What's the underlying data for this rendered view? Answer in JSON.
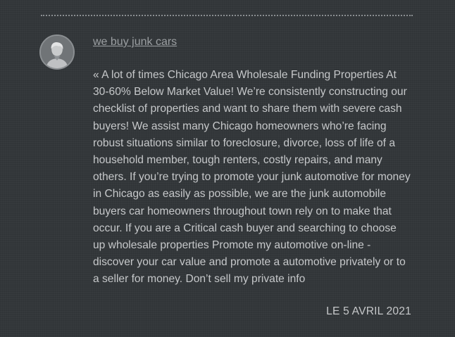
{
  "comment": {
    "author": "we buy junk cars",
    "avatar_icon": "user-avatar-icon",
    "body": "« A lot of times Chicago Area Wholesale Funding Properties At 30-60% Below Market Value! We’re consistently constructing our checklist of properties and want to share them with severe cash buyers! We assist many Chicago homeowners who’re facing robust situations similar to foreclosure, divorce, loss of life of a household member, tough renters, costly repairs, and many others. If you’re trying to promote your junk automotive for money in Chicago as easily as possible, we are the junk automobile buyers car homeowners throughout town rely on to make that occur. If you are a Critical cash buyer and searching to choose up wholesale properties Promote my automotive on-line - discover your car value and promote a automotive privately or to a seller for money. Don’t sell my private info",
    "date": "LE 5 AVRIL 2021"
  },
  "colors": {
    "background": "#33373a",
    "text": "#c6c8ca",
    "link": "#9b9fa2"
  }
}
